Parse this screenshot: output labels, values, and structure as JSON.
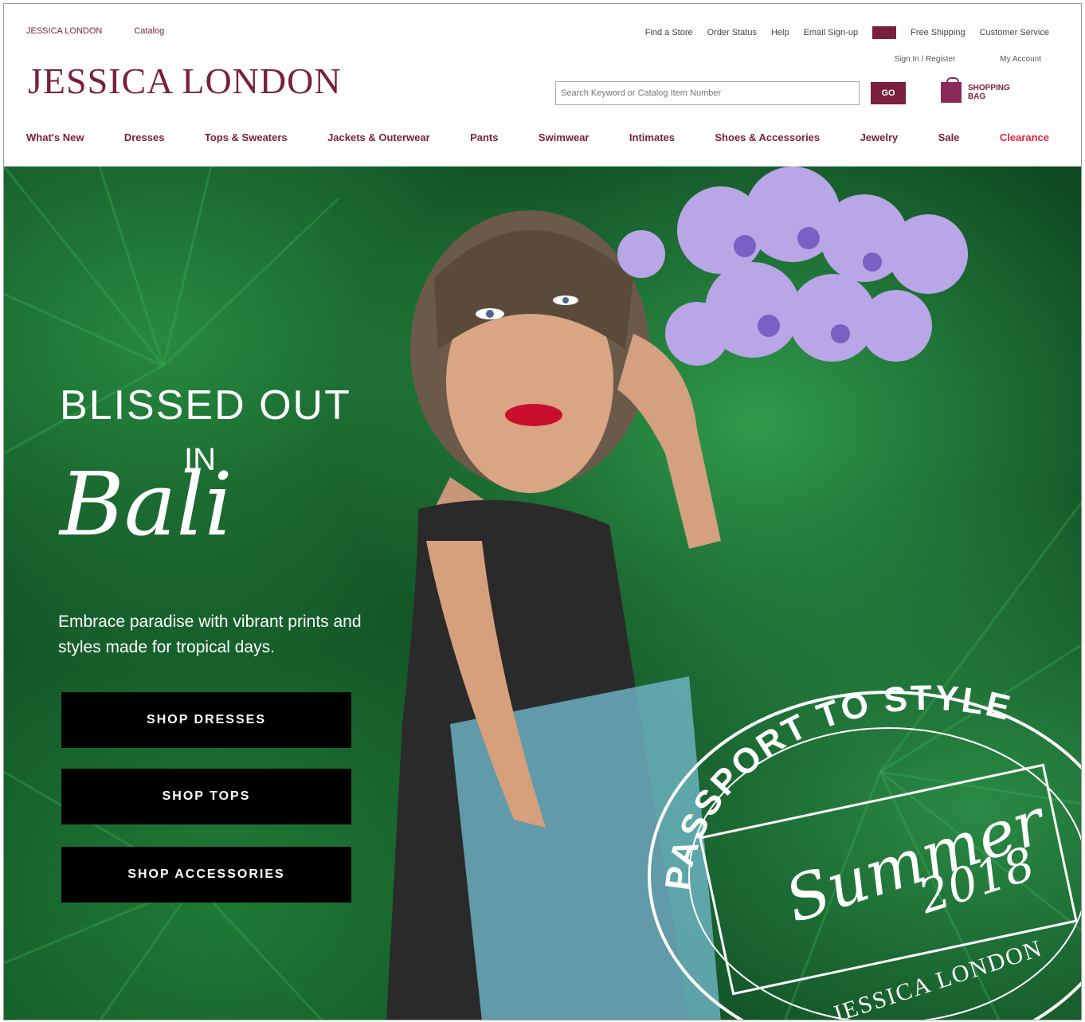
{
  "header": {
    "utility_left": [
      "JESSICA LONDON",
      "Catalog"
    ],
    "utility_right": [
      "Find a Store",
      "Order Status",
      "Help",
      "Email Sign-up",
      "Free Shipping",
      "Customer Service"
    ],
    "logo": "JESSICA LONDON",
    "account_links": [
      "Sign In / Register",
      "My Account"
    ],
    "search": {
      "placeholder": "Search Keyword or Catalog Item Number",
      "button": "GO"
    },
    "bag": {
      "line1": "SHOPPING",
      "line2": "BAG"
    }
  },
  "nav": {
    "items": [
      "What's New",
      "Dresses",
      "Tops & Sweaters",
      "Jackets & Outerwear",
      "Pants",
      "Swimwear",
      "Intimates",
      "Shoes & Accessories",
      "Jewelry",
      "Sale",
      "Clearance"
    ]
  },
  "hero": {
    "headline_line1": "BLISSED OUT",
    "headline_line2": "IN",
    "headline_script": "Bali",
    "subcopy": "Embrace paradise with vibrant prints and styles made for tropical days.",
    "buttons": [
      "SHOP DRESSES",
      "SHOP TOPS",
      "SHOP ACCESSORIES"
    ],
    "stamp": {
      "arc_text": "PASSPORT TO STYLE",
      "script": "Summer",
      "year": "2018",
      "brand": "JESSICA LONDON"
    }
  },
  "colors": {
    "brand": "#7a1f3d",
    "clearance": "#e0283c",
    "cta_bg": "#000000"
  }
}
